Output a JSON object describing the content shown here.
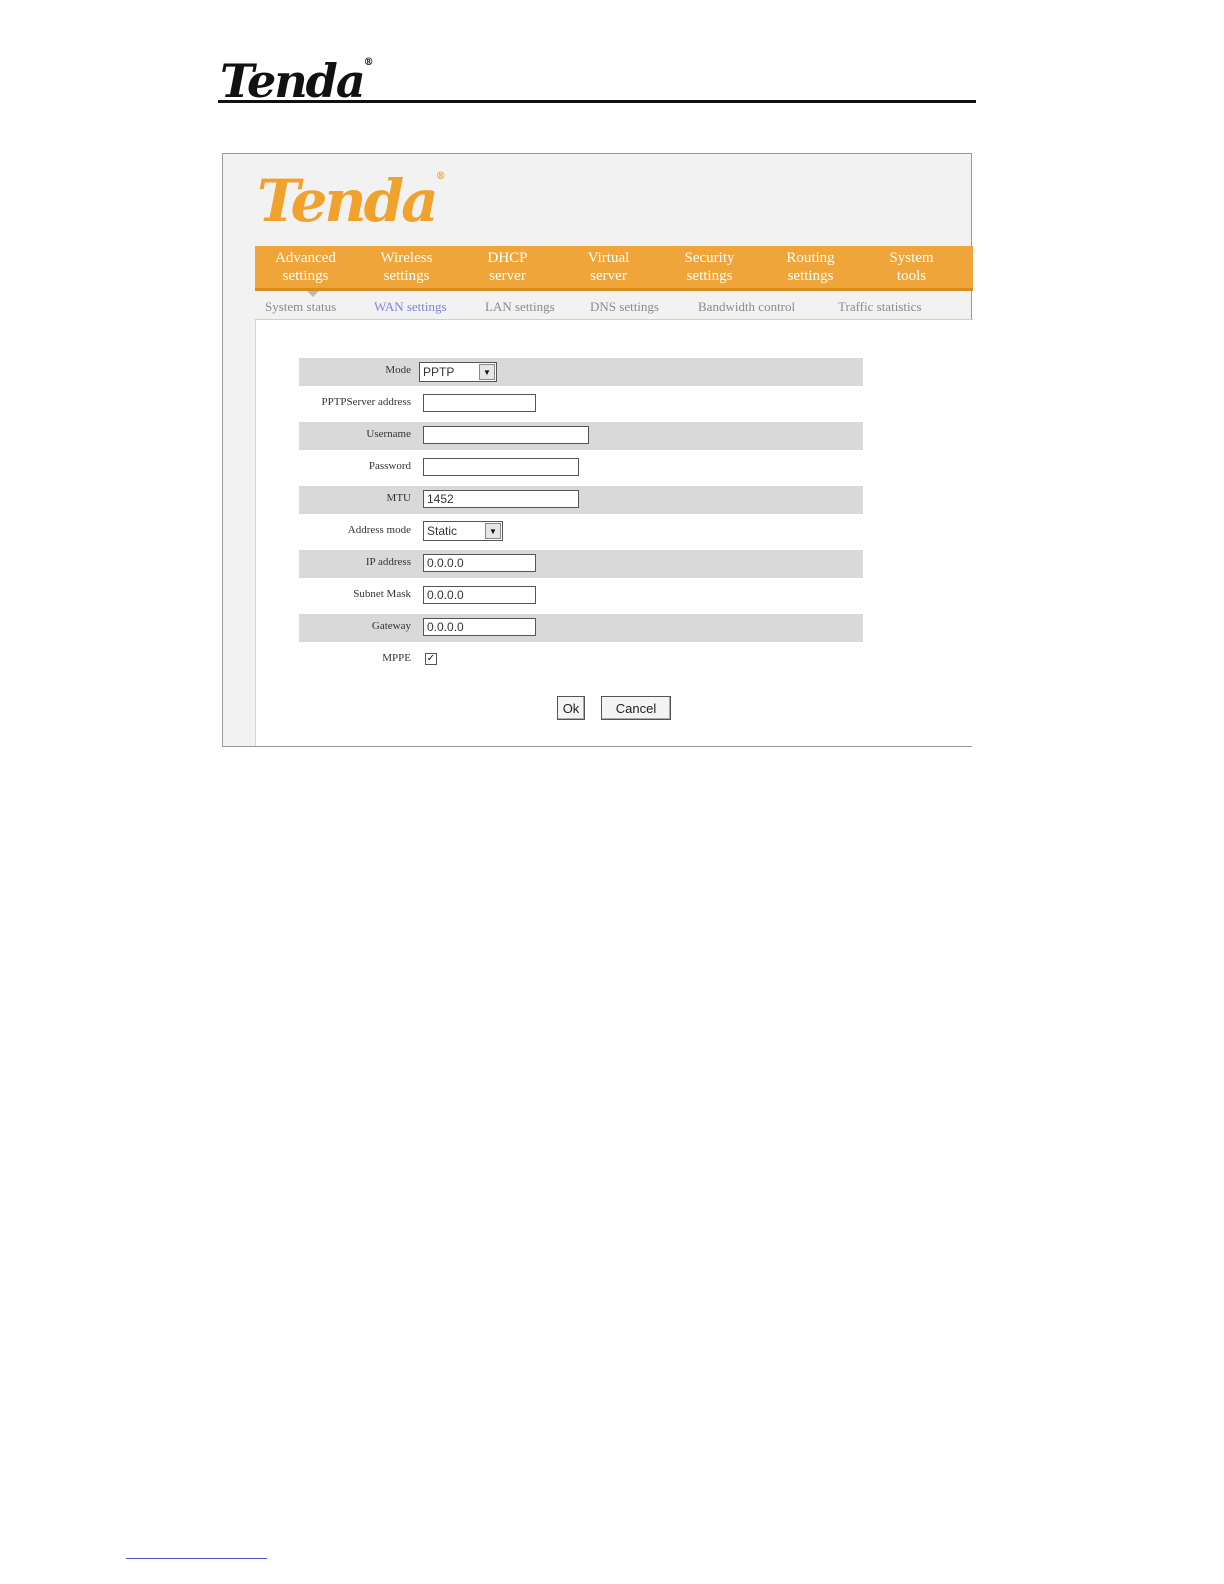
{
  "document": {
    "logo": "Tenda",
    "logo_mark": "®"
  },
  "app": {
    "logo": "Tenda",
    "logo_mark": "®",
    "accent_color": "#f0a53a"
  },
  "topnav": [
    {
      "line1": "Advanced",
      "line2": "settings"
    },
    {
      "line1": "Wireless",
      "line2": "settings"
    },
    {
      "line1": "DHCP",
      "line2": "server"
    },
    {
      "line1": "Virtual",
      "line2": "server"
    },
    {
      "line1": "Security",
      "line2": "settings"
    },
    {
      "line1": "Routing",
      "line2": "settings"
    },
    {
      "line1": "System",
      "line2": "tools"
    }
  ],
  "subnav": [
    "System status",
    "WAN settings",
    "LAN settings",
    "DNS settings",
    "Bandwidth control",
    "Traffic statistics"
  ],
  "form": {
    "mode_label": "Mode",
    "mode_value": "PPTP",
    "pptp_server_label": "PPTPServer address",
    "pptp_server_value": "",
    "username_label": "Username",
    "username_value": "",
    "password_label": "Password",
    "password_value": "",
    "mtu_label": "MTU",
    "mtu_value": "1452",
    "address_mode_label": "Address mode",
    "address_mode_value": "Static",
    "ip_label": "IP address",
    "ip_value": "0.0.0.0",
    "subnet_label": "Subnet Mask",
    "subnet_value": "0.0.0.0",
    "gateway_label": "Gateway",
    "gateway_value": "0.0.0.0",
    "mppe_label": "MPPE",
    "mppe_checked": true,
    "mppe_mark": "✓"
  },
  "buttons": {
    "ok_label": "Ok",
    "cancel_label": "Cancel"
  }
}
